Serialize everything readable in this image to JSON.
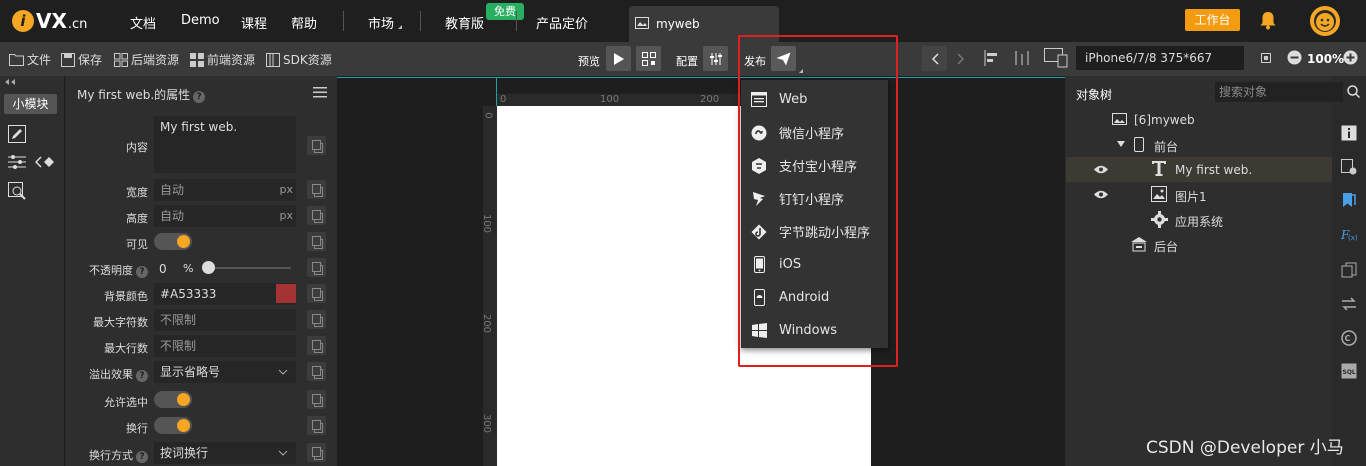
{
  "app": {
    "logo_letter": "i",
    "logo_text": "VX",
    "logo_suffix": ".cn"
  },
  "topnav": {
    "items": [
      "文档",
      "Demo",
      "课程",
      "帮助",
      "市场",
      "教育版",
      "产品定价"
    ],
    "free_badge": "免费",
    "tab": "myweb",
    "workbench": "工作台"
  },
  "toolbar": {
    "file": "文件",
    "save": "保存",
    "backend": "后端资源",
    "frontend": "前端资源",
    "sdk": "SDK资源",
    "preview": "预览",
    "config": "配置",
    "publish": "发布",
    "device": "iPhone6/7/8 375*667",
    "zoom": "100%"
  },
  "left": {
    "module_btn": "小模块"
  },
  "props": {
    "title": "My first web.的属性",
    "content_label": "内容",
    "content_value": "My first web.",
    "width_label": "宽度",
    "width_value": "自动",
    "width_unit": "px",
    "height_label": "高度",
    "height_value": "自动",
    "height_unit": "px",
    "visible_label": "可见",
    "opacity_label": "不透明度",
    "opacity_value": "0",
    "opacity_unit": "%",
    "bg_label": "背景颜色",
    "bg_value": "#A53333",
    "bg_color": "#A53333",
    "maxchars_label": "最大字符数",
    "maxchars_value": "不限制",
    "maxlines_label": "最大行数",
    "maxlines_value": "不限制",
    "overflow_label": "溢出效果",
    "overflow_value": "显示省略号",
    "selectable_label": "允许选中",
    "wrap_label": "换行",
    "wrapmode_label": "换行方式",
    "wrapmode_value": "按词换行"
  },
  "ruler": {
    "top": [
      "0",
      "100",
      "200"
    ],
    "left": [
      "0",
      "100",
      "200",
      "300"
    ]
  },
  "publish_menu": {
    "items": [
      {
        "label": "Web",
        "icon": "web-icon"
      },
      {
        "label": "微信小程序",
        "icon": "wechat-icon"
      },
      {
        "label": "支付宝小程序",
        "icon": "alipay-icon"
      },
      {
        "label": "钉钉小程序",
        "icon": "dingtalk-icon"
      },
      {
        "label": "字节跳动小程序",
        "icon": "bytedance-icon"
      },
      {
        "label": "iOS",
        "icon": "ios-icon"
      },
      {
        "label": "Android",
        "icon": "android-icon"
      },
      {
        "label": "Windows",
        "icon": "windows-icon"
      }
    ]
  },
  "tree": {
    "title": "对象树",
    "search_placeholder": "搜索对象",
    "rows": [
      "[6]myweb",
      "前台",
      "My first web.",
      "图片1",
      "应用系统",
      "后台"
    ]
  },
  "watermark": "CSDN @Developer 小马",
  "colors": {
    "accent": "#F39C12",
    "highlight_box": "#E02020",
    "badge": "#27AE60"
  }
}
